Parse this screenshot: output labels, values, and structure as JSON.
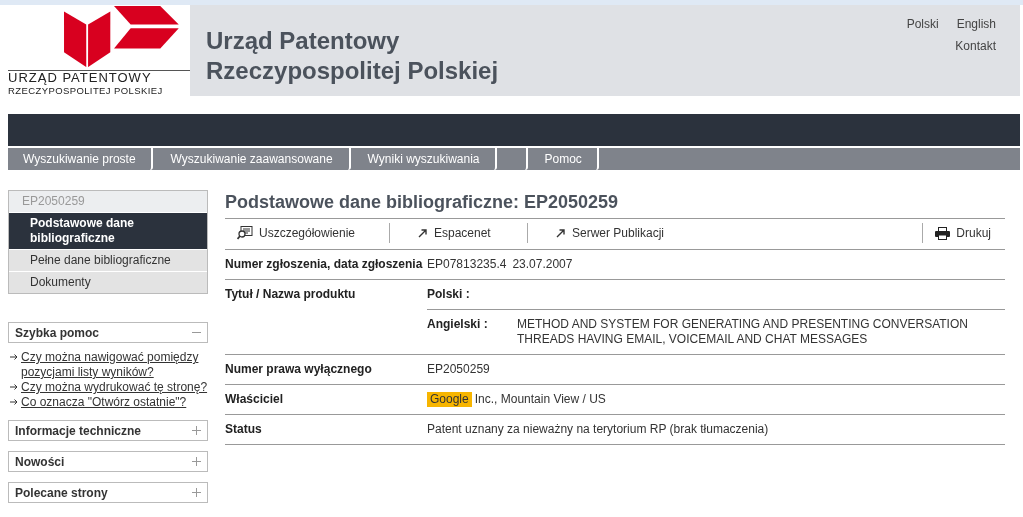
{
  "header": {
    "logo_line1": "URZĄD PATENTOWY",
    "logo_line2": "RZECZYPOSPOLITEJ POLSKIEJ",
    "title_line1": "Urząd Patentowy",
    "title_line2": "Rzeczypospolitej Polskiej",
    "languages": [
      "Polski",
      "English"
    ],
    "contact": "Kontakt"
  },
  "nav": [
    {
      "label": "Wyszukiwanie proste",
      "kind": "tab"
    },
    {
      "label": "Wyszukiwanie zaawansowane",
      "kind": "tab"
    },
    {
      "label": "Wyniki wyszukiwania",
      "kind": "tab"
    },
    {
      "kind": "spacer"
    },
    {
      "label": "Pomoc",
      "kind": "tab"
    }
  ],
  "sidebar": {
    "document": "EP2050259",
    "items": [
      {
        "label": "Podstawowe dane bibliograficzne",
        "selected": true
      },
      {
        "label": "Pełne dane bibliograficzne",
        "selected": false
      },
      {
        "label": "Dokumenty",
        "selected": false
      }
    ],
    "panels": [
      {
        "title": "Szybka pomoc",
        "expanded": true,
        "links": [
          "Czy można nawigować pomiędzy pozycjami listy wyników?",
          "Czy można wydrukować tę stronę?",
          "Co oznacza \"Otwórz ostatnie\"?"
        ]
      },
      {
        "title": "Informacje techniczne",
        "expanded": false
      },
      {
        "title": "Nowości",
        "expanded": false
      },
      {
        "title": "Polecane strony",
        "expanded": false
      }
    ]
  },
  "main": {
    "title": "Podstawowe dane bibliograficzne: EP2050259",
    "toolbar": [
      {
        "label": "Uszczegółowienie",
        "kind": "details"
      },
      {
        "label": "Espacenet",
        "kind": "external"
      },
      {
        "label": "Serwer Publikacji",
        "kind": "external"
      },
      {
        "label": "Drukuj",
        "kind": "print"
      }
    ],
    "rows": [
      {
        "label": "Numer zgłoszenia, data zgłoszenia",
        "kind": "pair",
        "values": [
          "EP07813235.4",
          "23.07.2007"
        ]
      },
      {
        "label": "Tytuł / Nazwa produktu",
        "kind": "titles",
        "titles": [
          {
            "language": "Polski :"
          },
          {
            "language": "Angielski :",
            "text": "METHOD AND SYSTEM FOR GENERATING AND PRESENTING CONVERSATION THREADS HAVING EMAIL, VOICEMAIL AND CHAT MESSAGES"
          }
        ]
      },
      {
        "label": "Numer prawa wyłącznego",
        "kind": "text",
        "value": "EP2050259"
      },
      {
        "label": "Właściciel",
        "kind": "highlight",
        "highlight": "Google",
        "value": "Inc., Mountain View / US"
      },
      {
        "label": "Status",
        "kind": "text",
        "value": "Patent uznany za nieważny na terytorium RP (brak tłumaczenia)"
      }
    ]
  }
}
